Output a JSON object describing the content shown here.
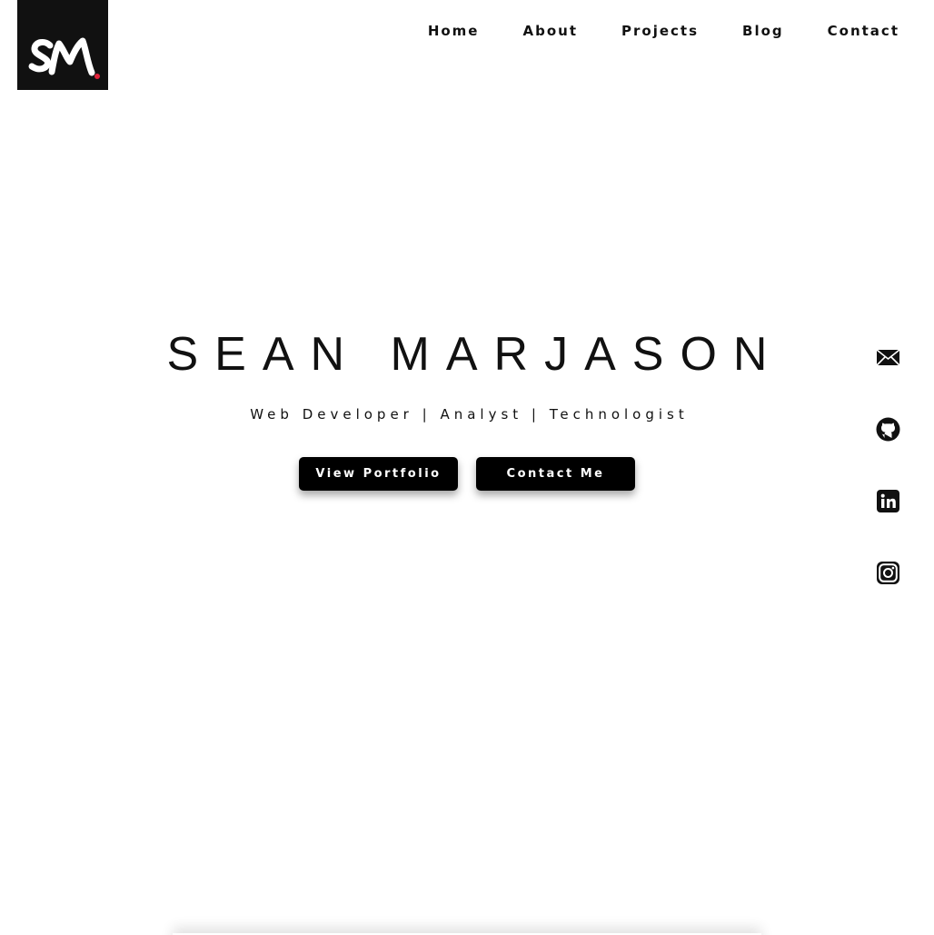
{
  "logo": {
    "text": "SM",
    "dot_color": "#e0233a",
    "background": "#111111"
  },
  "nav": {
    "items": [
      {
        "label": "Home"
      },
      {
        "label": "About"
      },
      {
        "label": "Projects"
      },
      {
        "label": "Blog"
      },
      {
        "label": "Contact"
      }
    ]
  },
  "hero": {
    "title": "SEAN MARJASON",
    "subtitle": "Web Developer | Analyst | Technologist",
    "buttons": {
      "portfolio_label": "View Portfolio",
      "contact_label": "Contact Me"
    }
  },
  "social": {
    "icons": [
      "mail-icon",
      "github-icon",
      "linkedin-icon",
      "instagram-icon"
    ]
  },
  "colors": {
    "text": "#111111",
    "button_bg": "#000000",
    "button_text": "#ffffff",
    "background": "#ffffff",
    "accent": "#e0233a"
  }
}
